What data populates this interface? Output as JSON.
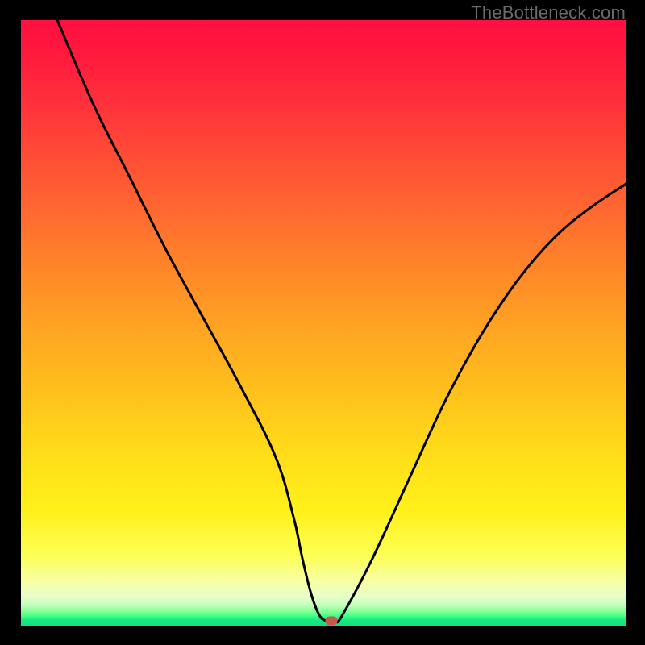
{
  "watermark": "TheBottleneck.com",
  "chart_data": {
    "type": "line",
    "title": "",
    "xlabel": "",
    "ylabel": "",
    "xlim": [
      0,
      100
    ],
    "ylim": [
      0,
      100
    ],
    "grid": false,
    "series": [
      {
        "name": "bottleneck-curve",
        "x": [
          6,
          12,
          18,
          24,
          30,
          36,
          42,
          45,
          46.5,
          48,
          49.5,
          51,
          52,
          53,
          58,
          64,
          70,
          76,
          82,
          88,
          94,
          100
        ],
        "y": [
          100,
          86,
          74,
          62,
          51,
          40,
          28,
          18,
          11,
          5,
          1.4,
          0.8,
          0.8,
          1.6,
          11,
          24,
          37,
          48,
          57,
          64,
          69,
          73
        ]
      }
    ],
    "marker": {
      "x": 51.2,
      "y": 0.8,
      "label": "optimal-point"
    },
    "gradient_stops": [
      {
        "pos": 0,
        "color": "#ff1040"
      },
      {
        "pos": 0.5,
        "color": "#ffbf1e"
      },
      {
        "pos": 0.88,
        "color": "#fcff55"
      },
      {
        "pos": 1.0,
        "color": "#0fe07e"
      }
    ]
  },
  "frame": {
    "bg": "#000000"
  }
}
